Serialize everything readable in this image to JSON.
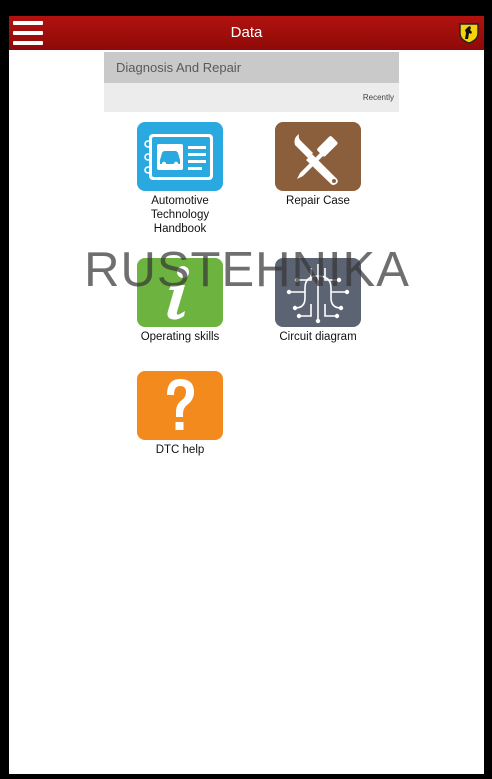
{
  "header": {
    "title": "Data",
    "menu_icon": "hamburger-menu-icon",
    "logo_icon": "prancing-horse-shield-icon"
  },
  "section": {
    "title": "Diagnosis And Repair",
    "recently_label": "Recently"
  },
  "tiles": [
    {
      "label": "Automotive\nTechnology\nHandbook",
      "icon": "car-handbook-icon",
      "color": "#29a9e0"
    },
    {
      "label": "Repair Case",
      "icon": "wrench-screwdriver-icon",
      "color": "#8b5e3c"
    },
    {
      "label": "Operating skills",
      "icon": "info-icon",
      "color": "#6cb33f"
    },
    {
      "label": "Circuit diagram",
      "icon": "circuit-icon",
      "color": "#5c6373"
    },
    {
      "label": "DTC help",
      "icon": "question-icon",
      "color": "#f28a1e"
    }
  ],
  "watermark": "RUSTEHNIKA"
}
